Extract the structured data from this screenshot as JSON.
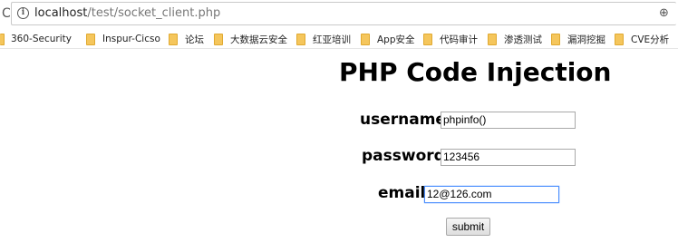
{
  "browser": {
    "url_host": "localhost",
    "url_path": "/test/socket_client.php",
    "reload_glyph": "C",
    "info_glyph": "i",
    "zoom_glyph": "⊕",
    "bookmarks": [
      {
        "label": "360-Security",
        "icon": "folder-icon"
      },
      {
        "label": "Inspur-Cicso",
        "icon": "folder-icon"
      },
      {
        "label": "论坛",
        "icon": "folder-icon"
      },
      {
        "label": "大数据云安全",
        "icon": "folder-icon"
      },
      {
        "label": "红亚培训",
        "icon": "folder-icon"
      },
      {
        "label": "App安全",
        "icon": "folder-icon"
      },
      {
        "label": "代码审计",
        "icon": "folder-icon"
      },
      {
        "label": "渗透测试",
        "icon": "folder-icon"
      },
      {
        "label": "漏洞挖掘",
        "icon": "folder-icon"
      },
      {
        "label": "CVE分析",
        "icon": "folder-icon"
      }
    ]
  },
  "page": {
    "title": "PHP Code Injection",
    "form": {
      "username_label": "username:",
      "username_value": "phpinfo()",
      "password_label": "password:",
      "password_value": "123456",
      "email_label": "email:",
      "email_value": "12@126.com",
      "submit_label": "submit"
    }
  },
  "colors": {
    "focus_border": "#4d90fe",
    "folder": "#f5c65c"
  }
}
